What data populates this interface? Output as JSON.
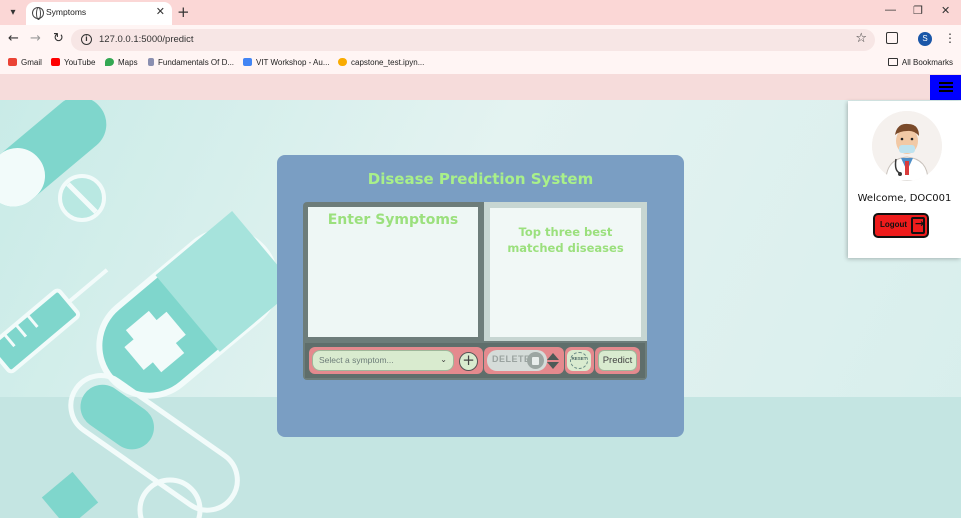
{
  "browser": {
    "tab_title": "Symptoms",
    "tab_close": "✕",
    "new_tab": "+",
    "url": "127.0.0.1:5000/predict",
    "profile_initial": "S",
    "bookmarks": [
      "Gmail",
      "YouTube",
      "Maps",
      "Fundamentals Of D...",
      "VIT Workshop - Au...",
      "capstone_test.ipyn..."
    ],
    "all_bookmarks": "All Bookmarks"
  },
  "app": {
    "title": "Disease Prediction System",
    "symptoms_heading": "Enter Symptoms",
    "results_heading": "Top three best matched diseases",
    "select_placeholder": "Select a symptom...",
    "add_symbol": "+",
    "delete_label": "DELETE",
    "reset_label": "RESET",
    "predict_label": "Predict"
  },
  "user": {
    "welcome": "Welcome, DOC001",
    "logout_label": "Logout"
  },
  "colors": {
    "accent": "#0000ff",
    "panel": "#7a9ec3",
    "title_green": "#a9f08a",
    "logout_red": "#ee1c1c"
  }
}
